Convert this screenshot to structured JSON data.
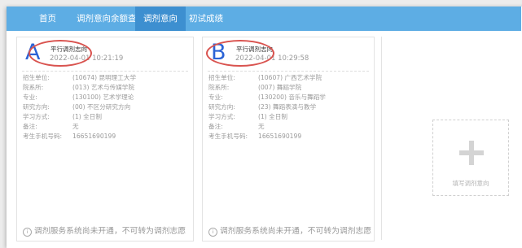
{
  "nav": {
    "items": [
      {
        "label": "首页",
        "active": false
      },
      {
        "label": "调剂意向余额查询",
        "active": false
      },
      {
        "label": "调剂意向",
        "active": true
      },
      {
        "label": "初试成绩",
        "active": false
      }
    ]
  },
  "field_labels": {
    "unit": "招生单位:",
    "department": "院系所:",
    "major": "专业:",
    "direction": "研究方向:",
    "study_mode": "学习方式:",
    "remark": "备注:",
    "phone": "考生手机号码:"
  },
  "cards": [
    {
      "letter": "A",
      "letter_color": "#2b63d6",
      "tag": "平行调剂志向",
      "time": "2022-04-01 10:21:19",
      "unit": "(10674) 昆明理工大学",
      "department": "(013) 艺术与传媒学院",
      "major": "(130100) 艺术学理论",
      "direction": "(00) 不区分研究方向",
      "study_mode": "(1) 全日制",
      "remark": "无",
      "phone": "16651690199",
      "notice": "调剂服务系统尚未开通，不可转为调剂志愿"
    },
    {
      "letter": "B",
      "letter_color": "#2b63d6",
      "tag": "平行调剂志向",
      "time": "2022-04-01 10:29:58",
      "unit": "(10607) 广西艺术学院",
      "department": "(007) 舞蹈学院",
      "major": "(130200) 音乐与舞蹈学",
      "direction": "(23) 舞蹈表演与教学",
      "study_mode": "(1) 全日制",
      "remark": "无",
      "phone": "16651690199",
      "notice": "调剂服务系统尚未开通，不可转为调剂志愿"
    }
  ],
  "add_card": {
    "label": "填写调剂意向",
    "icon": "plus-icon"
  },
  "colors": {
    "nav_bg": "#5dade4",
    "nav_active": "#3d8fd0",
    "annotation_red": "#d9534f"
  }
}
